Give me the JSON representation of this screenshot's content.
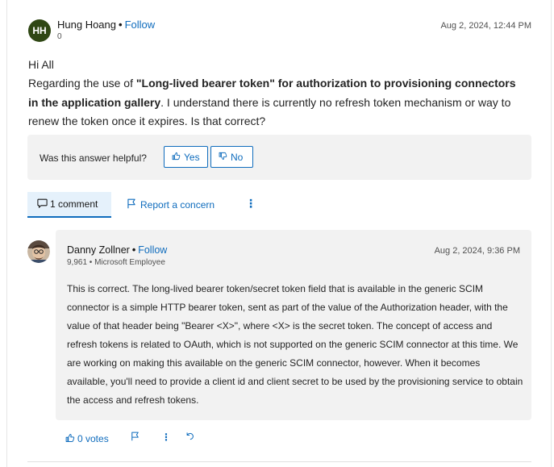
{
  "question": {
    "author": {
      "initials": "HH",
      "name": "Hung Hoang",
      "separator": "•",
      "follow_label": "Follow",
      "reputation": "0",
      "avatar_color": "#2f4714"
    },
    "date": "Aug 2, 2024, 12:44 PM",
    "greeting": "Hi All",
    "body_prefix": "Regarding the use of ",
    "body_bold": "\"Long-lived bearer token\" for authorization to provisioning connectors in the application gallery",
    "body_suffix": ". I understand there is currently no refresh token mechanism or way to renew the token once it expires. Is that correct?",
    "helpful": {
      "label": "Was this answer helpful?",
      "yes_label": "Yes",
      "no_label": "No"
    },
    "comments_tab_label": "1 comment",
    "report_label": "Report a concern"
  },
  "comment": {
    "author": {
      "name": "Danny Zollner",
      "separator": "•",
      "follow_label": "Follow",
      "reputation_line": "9,961 • Microsoft Employee"
    },
    "date": "Aug 2, 2024, 9:36 PM",
    "body": "This is correct. The long-lived bearer token/secret token field that is available in the generic SCIM connector is a simple HTTP bearer token, sent as part of the value of the Authorization header, with the value of that header being \"Bearer <X>\", where <X> is the secret token. The concept of access and refresh tokens is related to OAuth, which is not supported on the generic SCIM connector at this time. We are working on making this available on the generic SCIM connector, however. When it becomes available, you'll need to provide a client id and client secret to be used by the provisioning service to obtain the access and refresh tokens.",
    "votes_label": "0 votes"
  },
  "icons": {
    "thumbs_up": "thumbs-up-icon",
    "thumbs_down": "thumbs-down-icon",
    "comment": "comment-icon",
    "flag": "flag-icon",
    "more": "more-vertical-icon",
    "reply": "reply-icon"
  },
  "colors": {
    "accent": "#0f6cbd",
    "panel_bg": "#f2f2f2",
    "tab_bg": "#e5f1fb"
  }
}
